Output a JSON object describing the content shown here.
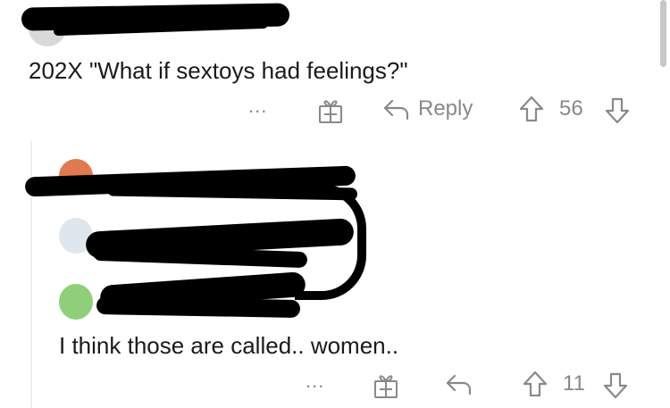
{
  "comments": [
    {
      "text": "202X \"What if sextoys had feelings?\"",
      "more_label": "...",
      "reply_label": "Reply",
      "score": "56",
      "icons": [
        "avatar-icon",
        "award-icon",
        "reply-icon",
        "upvote-icon",
        "downvote-icon"
      ]
    },
    {
      "text": "I think those are called.. women..",
      "more_label": "...",
      "score": "11",
      "icons": [
        "avatar-icon",
        "award-icon",
        "reply-icon",
        "upvote-icon",
        "downvote-icon"
      ]
    }
  ],
  "colors": {
    "text": "#1a1a1b",
    "muted": "#878a8c",
    "redaction": "#000000"
  }
}
